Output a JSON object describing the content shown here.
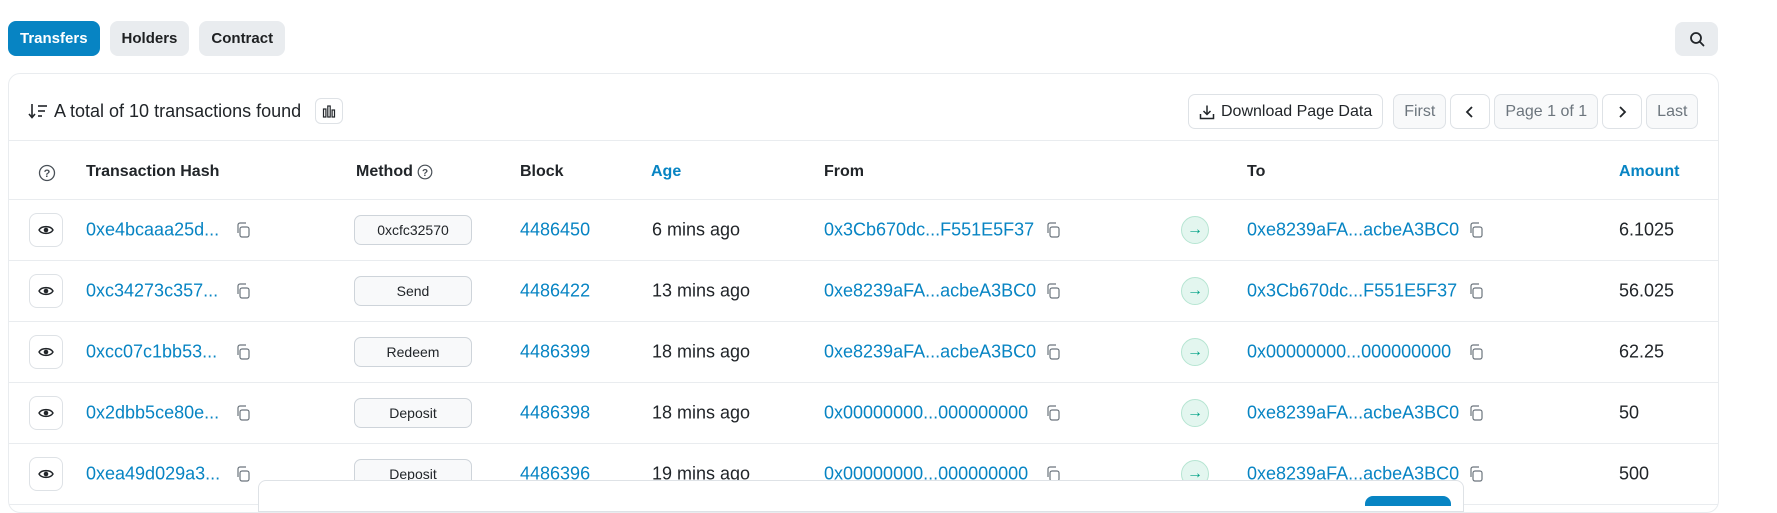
{
  "tabs": [
    {
      "label": "Transfers",
      "active": true
    },
    {
      "label": "Holders",
      "active": false
    },
    {
      "label": "Contract",
      "active": false
    }
  ],
  "summary": {
    "text": "A total of 10 transactions found"
  },
  "toolbar": {
    "download_label": "Download Page Data",
    "first_label": "First",
    "page_info": "Page 1 of 1",
    "last_label": "Last"
  },
  "columns": {
    "hash": "Transaction Hash",
    "method": "Method",
    "block": "Block",
    "age": "Age",
    "from": "From",
    "to": "To",
    "amount": "Amount"
  },
  "rows": [
    {
      "hash": "0xe4bcaaa25d...",
      "method": "0xcfc32570",
      "block": "4486450",
      "age": "6 mins ago",
      "from": "0x3Cb670dc...F551E5F37",
      "to": "0xe8239aFA...acbeA3BC0",
      "amount": "6.1025"
    },
    {
      "hash": "0xc34273c357...",
      "method": "Send",
      "block": "4486422",
      "age": "13 mins ago",
      "from": "0xe8239aFA...acbeA3BC0",
      "to": "0x3Cb670dc...F551E5F37",
      "amount": "56.025"
    },
    {
      "hash": "0xcc07c1bb53...",
      "method": "Redeem",
      "block": "4486399",
      "age": "18 mins ago",
      "from": "0xe8239aFA...acbeA3BC0",
      "to": "0x00000000...000000000",
      "amount": "62.25"
    },
    {
      "hash": "0x2dbb5ce80e...",
      "method": "Deposit",
      "block": "4486398",
      "age": "18 mins ago",
      "from": "0x00000000...000000000",
      "to": "0xe8239aFA...acbeA3BC0",
      "amount": "50"
    },
    {
      "hash": "0xea49d029a3...",
      "method": "Deposit",
      "block": "4486396",
      "age": "19 mins ago",
      "from": "0x00000000...000000000",
      "to": "0xe8239aFA...acbeA3BC0",
      "amount": "500"
    }
  ],
  "colors": {
    "accent": "#0784c3",
    "success": "#00a186"
  }
}
